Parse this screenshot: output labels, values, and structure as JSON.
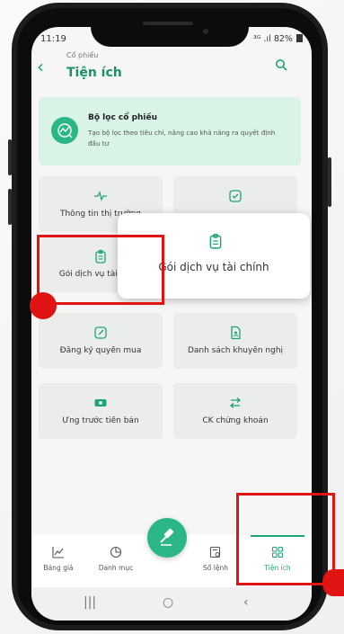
{
  "status_bar": {
    "time": "11:19",
    "signal": "³ᴳ .ıl",
    "battery": "82%"
  },
  "header": {
    "breadcrumb": "Cổ phiếu",
    "title": "Tiện ích"
  },
  "banner": {
    "title": "Bộ lọc cổ phiếu",
    "description": "Tạo bộ lọc theo tiêu chí, nâng cao khả năng ra quyết định đầu tư",
    "icon": "chart-search-icon"
  },
  "grid": [
    {
      "label": "Thông tin thị trường",
      "icon": "pulse-icon"
    },
    {
      "label": "",
      "icon": "check-square-icon"
    },
    {
      "label": "Gói dịch vụ tài chính",
      "icon": "clipboard-icon"
    },
    {
      "label": "",
      "icon": ""
    },
    {
      "label": "Đăng ký quyền mua",
      "icon": "edit-icon"
    },
    {
      "label": "Danh sách khuyến nghị",
      "icon": "document-icon"
    },
    {
      "label": "Ứng trước tiền bán",
      "icon": "cash-icon"
    },
    {
      "label": "CK chứng khoán",
      "icon": "transfer-icon"
    }
  ],
  "popup": {
    "label": "Gói dịch vụ tài chính",
    "icon": "clipboard-icon"
  },
  "tabbar": [
    {
      "label": "Bảng giá",
      "icon": "line-chart-icon"
    },
    {
      "label": "Danh mục",
      "icon": "pie-chart-icon"
    },
    {
      "label": "Sổ lệnh",
      "icon": "order-book-icon"
    },
    {
      "label": "Tiện ích",
      "icon": "grid-icon",
      "active": true
    }
  ],
  "fab": {
    "icon": "hammer-icon"
  },
  "colors": {
    "accent": "#1fa37a",
    "highlight": "#e11414",
    "banner_bg": "#d9f3e6"
  }
}
